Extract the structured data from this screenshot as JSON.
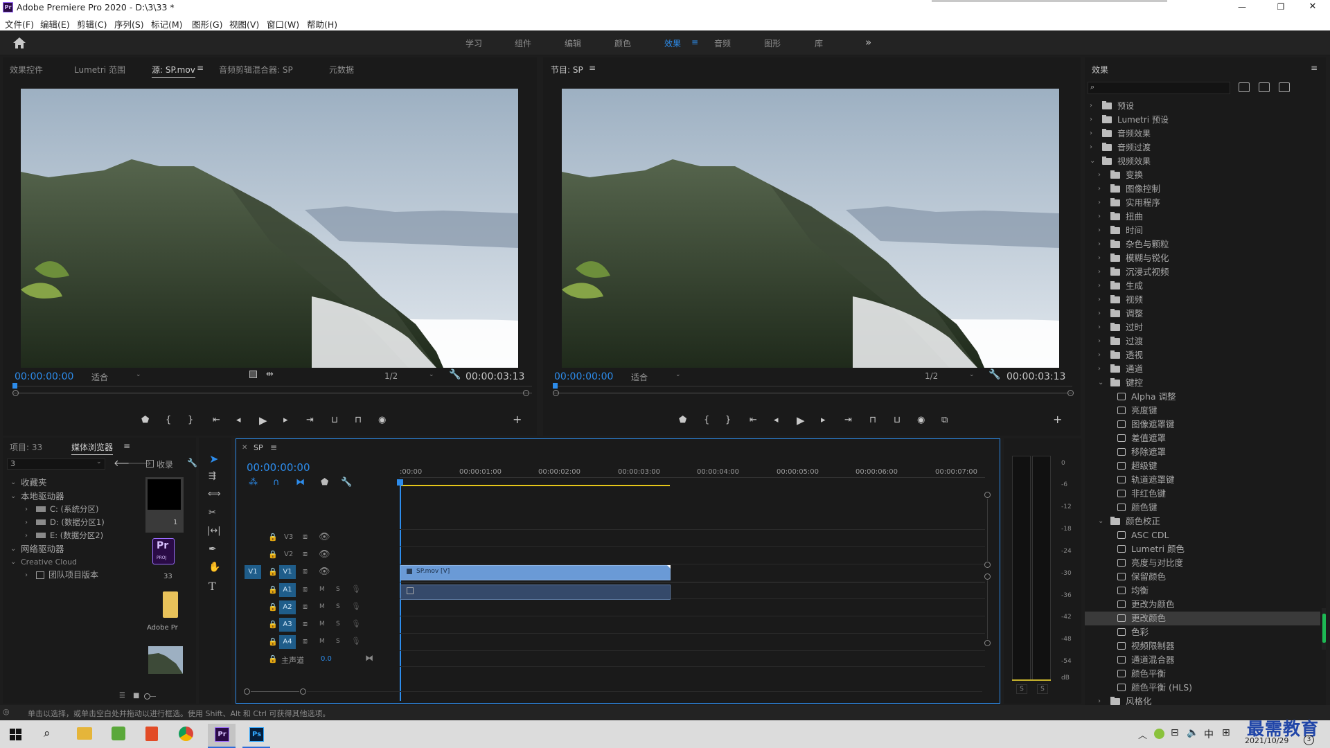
{
  "window": {
    "title": "Adobe Premiere Pro 2020 - D:\\3\\33 *",
    "app_icon": "Pr",
    "controls": [
      "—",
      "❐",
      "✕"
    ]
  },
  "menu": [
    "文件(F)",
    "编辑(E)",
    "剪辑(C)",
    "序列(S)",
    "标记(M)",
    "图形(G)",
    "视图(V)",
    "窗口(W)",
    "帮助(H)"
  ],
  "workspaces": [
    "学习",
    "组件",
    "编辑",
    "颜色",
    "效果",
    "音频",
    "图形",
    "库"
  ],
  "active_workspace": "效果",
  "source_monitor": {
    "tabs": [
      "效果控件",
      "Lumetri 范围",
      "源: SP.mov",
      "音频剪辑混合器: SP",
      "元数据"
    ],
    "timecode": "00:00:00:00",
    "fit": "适合",
    "resolution": "1/2",
    "duration": "00:00:03:13"
  },
  "program_monitor": {
    "title": "节目: SP",
    "timecode": "00:00:00:00",
    "fit": "适合",
    "resolution": "1/2",
    "duration": "00:00:03:13"
  },
  "project": {
    "tabs": [
      "项目: 33",
      "媒体浏览器"
    ],
    "path_value": "3",
    "ingest_label": "收录",
    "tree": [
      {
        "label": "收藏夹",
        "level": 0
      },
      {
        "label": "本地驱动器",
        "level": 0
      },
      {
        "label": "C: (系统分区)",
        "level": 1
      },
      {
        "label": "D: (数据分区1)",
        "level": 1
      },
      {
        "label": "E: (数据分区2)",
        "level": 1
      },
      {
        "label": "网络驱动器",
        "level": 0
      },
      {
        "label": "Creative Cloud",
        "level": 0
      },
      {
        "label": "团队项目版本",
        "level": 1
      }
    ],
    "thumbs": [
      "1",
      "33",
      "Adobe Pr"
    ],
    "pr_badge": "Pr",
    "proj_badge": "PROJ"
  },
  "timeline": {
    "sequence": "SP",
    "timecode": "00:00:00:00",
    "ruler": [
      ":00:00",
      "00:00:01:00",
      "00:00:02:00",
      "00:00:03:00",
      "00:00:04:00",
      "00:00:05:00",
      "00:00:06:00",
      "00:00:07:00"
    ],
    "video_tracks": [
      "V3",
      "V2",
      "V1"
    ],
    "audio_tracks": [
      "A1",
      "A2",
      "A3",
      "A4"
    ],
    "source_patch": "V1",
    "master": "主声道",
    "master_value": "0.0",
    "clip_label": "SP.mov [V]",
    "m": "M",
    "s": "S"
  },
  "meter": {
    "scale": [
      "0",
      "-6",
      "-12",
      "-18",
      "-24",
      "-30",
      "-36",
      "-42",
      "-48",
      "-54",
      "dB"
    ],
    "solo": [
      "S",
      "S"
    ]
  },
  "effects": {
    "title": "效果",
    "groups": [
      {
        "label": "预设",
        "kind": "folder",
        "level": 0,
        "open": false
      },
      {
        "label": "Lumetri 预设",
        "kind": "folder",
        "level": 0,
        "open": false
      },
      {
        "label": "音频效果",
        "kind": "folder",
        "level": 0,
        "open": false
      },
      {
        "label": "音频过渡",
        "kind": "folder",
        "level": 0,
        "open": false
      },
      {
        "label": "视频效果",
        "kind": "folder",
        "level": 0,
        "open": true
      },
      {
        "label": "变换",
        "kind": "folder",
        "level": 1,
        "open": false
      },
      {
        "label": "图像控制",
        "kind": "folder",
        "level": 1,
        "open": false
      },
      {
        "label": "实用程序",
        "kind": "folder",
        "level": 1,
        "open": false
      },
      {
        "label": "扭曲",
        "kind": "folder",
        "level": 1,
        "open": false
      },
      {
        "label": "时间",
        "kind": "folder",
        "level": 1,
        "open": false
      },
      {
        "label": "杂色与颗粒",
        "kind": "folder",
        "level": 1,
        "open": false
      },
      {
        "label": "模糊与锐化",
        "kind": "folder",
        "level": 1,
        "open": false
      },
      {
        "label": "沉浸式视频",
        "kind": "folder",
        "level": 1,
        "open": false
      },
      {
        "label": "生成",
        "kind": "folder",
        "level": 1,
        "open": false
      },
      {
        "label": "视频",
        "kind": "folder",
        "level": 1,
        "open": false
      },
      {
        "label": "调整",
        "kind": "folder",
        "level": 1,
        "open": false
      },
      {
        "label": "过时",
        "kind": "folder",
        "level": 1,
        "open": false
      },
      {
        "label": "过渡",
        "kind": "folder",
        "level": 1,
        "open": false
      },
      {
        "label": "透视",
        "kind": "folder",
        "level": 1,
        "open": false
      },
      {
        "label": "通道",
        "kind": "folder",
        "level": 1,
        "open": false
      },
      {
        "label": "键控",
        "kind": "folder",
        "level": 1,
        "open": true
      },
      {
        "label": "Alpha 调整",
        "kind": "fx",
        "level": 2
      },
      {
        "label": "亮度键",
        "kind": "fx",
        "level": 2
      },
      {
        "label": "图像遮罩键",
        "kind": "fx",
        "level": 2
      },
      {
        "label": "差值遮罩",
        "kind": "fx",
        "level": 2
      },
      {
        "label": "移除遮罩",
        "kind": "fx",
        "level": 2
      },
      {
        "label": "超级键",
        "kind": "fx",
        "level": 2
      },
      {
        "label": "轨道遮罩键",
        "kind": "fx",
        "level": 2
      },
      {
        "label": "非红色键",
        "kind": "fx",
        "level": 2
      },
      {
        "label": "颜色键",
        "kind": "fx",
        "level": 2
      },
      {
        "label": "颜色校正",
        "kind": "folder",
        "level": 1,
        "open": true
      },
      {
        "label": "ASC CDL",
        "kind": "fx",
        "level": 2
      },
      {
        "label": "Lumetri 颜色",
        "kind": "fx",
        "level": 2
      },
      {
        "label": "亮度与对比度",
        "kind": "fx",
        "level": 2
      },
      {
        "label": "保留颜色",
        "kind": "fx",
        "level": 2
      },
      {
        "label": "均衡",
        "kind": "fx",
        "level": 2
      },
      {
        "label": "更改为颜色",
        "kind": "fx",
        "level": 2
      },
      {
        "label": "更改颜色",
        "kind": "fx",
        "level": 2,
        "selected": true
      },
      {
        "label": "色彩",
        "kind": "fx",
        "level": 2
      },
      {
        "label": "视频限制器",
        "kind": "fx",
        "level": 2
      },
      {
        "label": "通道混合器",
        "kind": "fx",
        "level": 2
      },
      {
        "label": "颜色平衡",
        "kind": "fx",
        "level": 2
      },
      {
        "label": "颜色平衡 (HLS)",
        "kind": "fx",
        "level": 2
      },
      {
        "label": "风格化",
        "kind": "folder",
        "level": 1,
        "open": false
      }
    ]
  },
  "status_bar": "单击以选择，或单击空白处并拖动以进行框选。使用 Shift、Alt 和 Ctrl 可获得其他选项。",
  "taskbar": {
    "ime": "中",
    "date": "2021/10/29",
    "watermark": "最需教育",
    "badge": "3"
  },
  "colors": {
    "accent_blue": "#2d8ceb",
    "clip_blue": "#6a9ad6",
    "panel_bg": "#1a1a1a"
  }
}
